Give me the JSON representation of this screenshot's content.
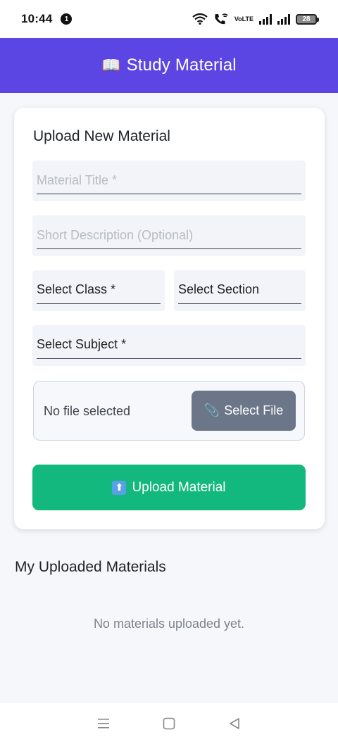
{
  "status_bar": {
    "time": "10:44",
    "notification_count": "1",
    "volte_top": "Vo",
    "volte_bottom": "LTE",
    "battery": "28"
  },
  "header": {
    "icon": "📖",
    "title": "Study Material"
  },
  "upload_form": {
    "title": "Upload New Material",
    "title_placeholder": "Material Title *",
    "description_placeholder": "Short Description (Optional)",
    "class_select": "Select Class *",
    "section_select": "Select Section",
    "subject_select": "Select Subject *",
    "file_status": "No file selected",
    "select_file_icon": "📎",
    "select_file_label": "Select File",
    "upload_icon": "⬆",
    "upload_label": "Upload Material"
  },
  "uploaded": {
    "title": "My Uploaded Materials",
    "empty_message": "No materials uploaded yet."
  },
  "colors": {
    "header_bg": "#5b46e3",
    "upload_button": "#13b87f",
    "select_file_button": "#6b7789"
  },
  "icons": {
    "book": "book-icon",
    "paperclip": "paperclip-icon",
    "upload": "upload-arrow-icon",
    "nav_menu": "menu-icon",
    "nav_home": "home-square-icon",
    "nav_back": "back-triangle-icon"
  }
}
